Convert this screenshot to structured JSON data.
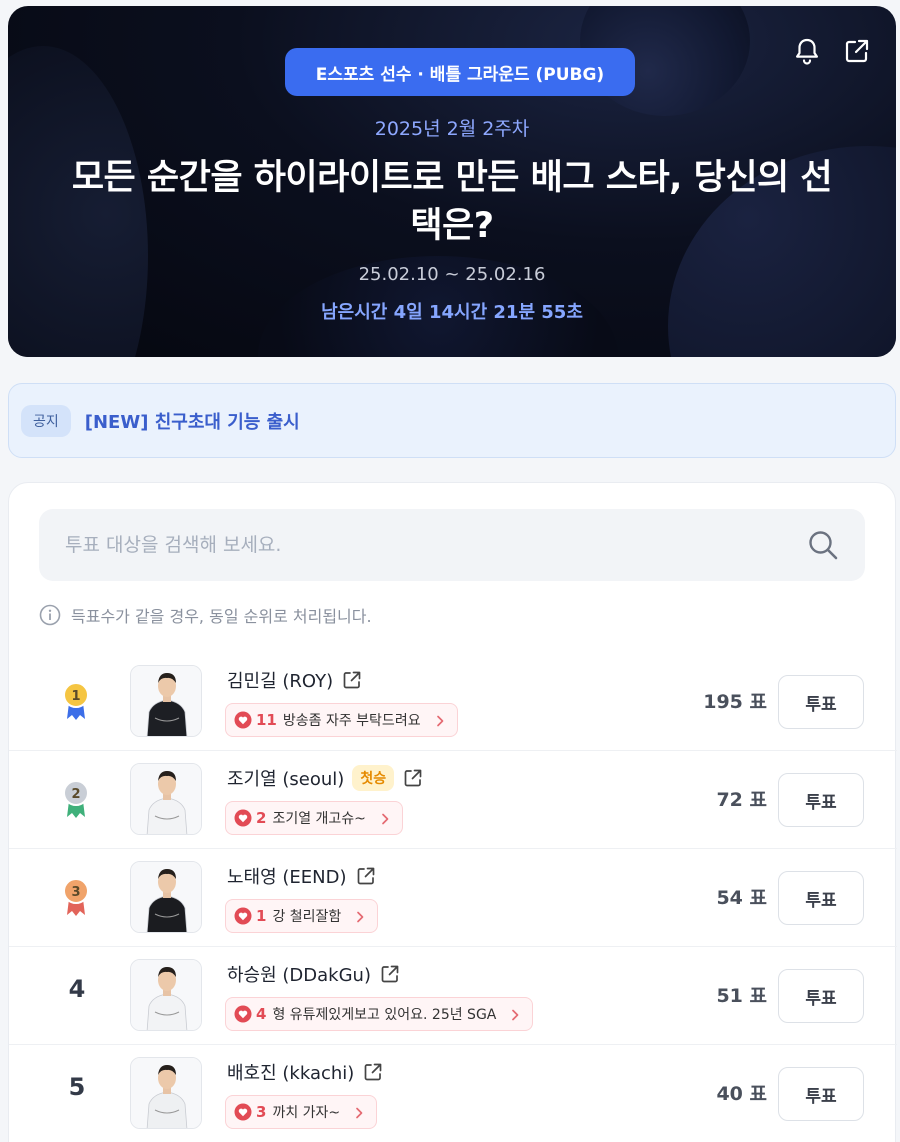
{
  "hero": {
    "category": "E스포츠 선수 · 배틀 그라운드 (PUBG)",
    "week": "2025년 2월 2주차",
    "title": "모든 순간을 하이라이트로 만든 배그 스타, 당신의 선택은?",
    "dates": "25.02.10 ~ 25.02.16",
    "remaining": "남은시간 4일 14시간 21분 55초"
  },
  "notice": {
    "tag": "공지",
    "text": "[NEW] 친구초대 기능 출시"
  },
  "search": {
    "placeholder": "투표 대상을 검색해 보세요."
  },
  "info": "득표수가 같을 경우, 동일 순위로 처리됩니다.",
  "colors": {
    "accent": "#3a6cf0",
    "gold": "#f5c542",
    "silver": "#c9ced6",
    "bronze": "#f0a36a",
    "heart": "#e24b55"
  },
  "players": [
    {
      "rank": "1",
      "medal": "gold",
      "name": "김민길 (ROY)",
      "badge": "",
      "cheer_count": "11",
      "cheer_msg": "방송좀 자주 부탁드려요",
      "votes": "195 표",
      "vote_label": "투표"
    },
    {
      "rank": "2",
      "medal": "silver",
      "name": "조기열 (seoul)",
      "badge": "첫승",
      "cheer_count": "2",
      "cheer_msg": "조기열 개고슈~",
      "votes": "72 표",
      "vote_label": "투표"
    },
    {
      "rank": "3",
      "medal": "bronze",
      "name": "노태영 (EEND)",
      "badge": "",
      "cheer_count": "1",
      "cheer_msg": "강 철리잘함",
      "votes": "54 표",
      "vote_label": "투표"
    },
    {
      "rank": "4",
      "medal": "",
      "name": "하승원 (DDakGu)",
      "badge": "",
      "cheer_count": "4",
      "cheer_msg": "형 유튜제있게보고 있어요. 25년 SGA",
      "votes": "51 표",
      "vote_label": "투표"
    },
    {
      "rank": "5",
      "medal": "",
      "name": "배호진 (kkachi)",
      "badge": "",
      "cheer_count": "3",
      "cheer_msg": "까치 가자~",
      "votes": "40 표",
      "vote_label": "투표"
    }
  ]
}
